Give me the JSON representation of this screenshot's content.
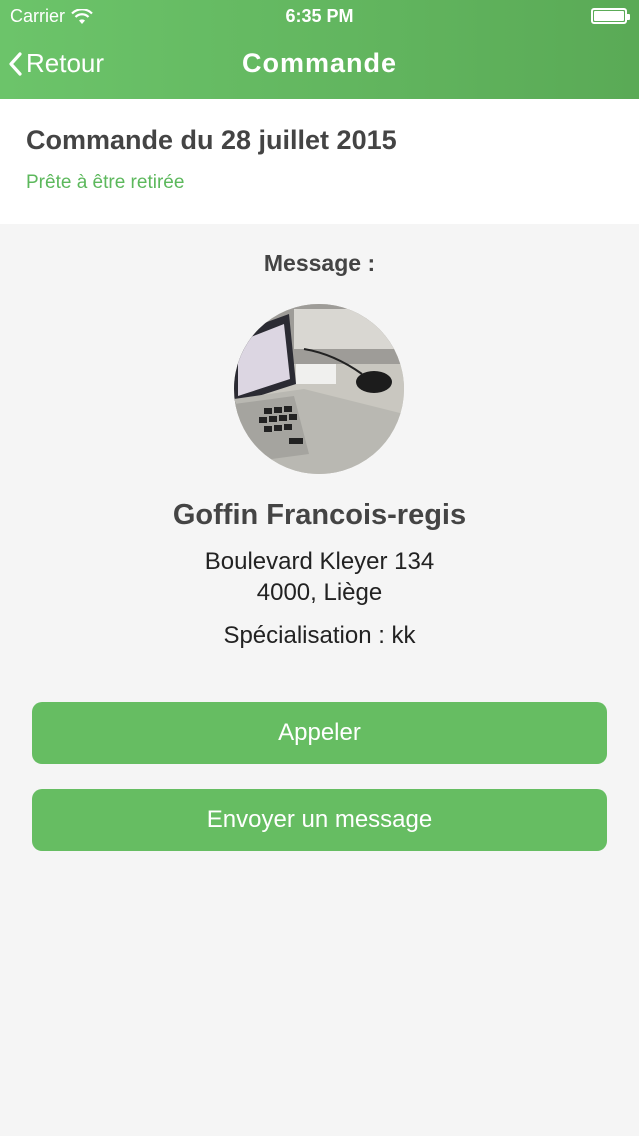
{
  "status_bar": {
    "carrier": "Carrier",
    "time": "6:35 PM",
    "wifi_icon": "wifi-icon",
    "battery_icon": "battery-icon"
  },
  "nav": {
    "back_label": "Retour",
    "back_icon": "chevron-left-icon",
    "title": "Commande"
  },
  "order": {
    "title": "Commande du 28 juillet 2015",
    "status": "Prête à être retirée"
  },
  "message_label": "Message :",
  "contact": {
    "avatar": "avatar-photo",
    "name": "Goffin Francois-regis",
    "address_line1": "Boulevard Kleyer 134",
    "address_line2": "4000, Liège",
    "specialisation": "Spécialisation : kk"
  },
  "actions": {
    "call_label": "Appeler",
    "message_label": "Envoyer un message"
  },
  "colors": {
    "accent": "#66bd62",
    "header": "#5fb35c",
    "status_text": "#5cb85c",
    "background": "#f5f5f5"
  }
}
